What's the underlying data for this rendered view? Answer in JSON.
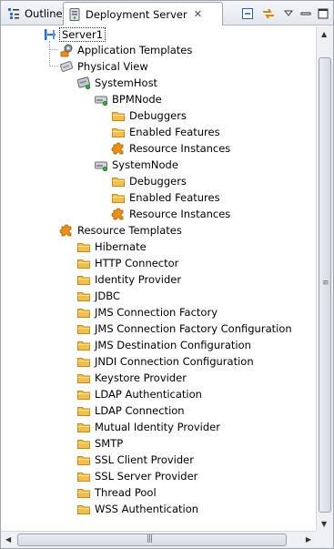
{
  "tabs": {
    "outline_label": "Outline",
    "active_label": "Deployment Server",
    "close_glyph": "✕"
  },
  "toolbar": {
    "collapse_icon": "collapse-all-icon",
    "link_icon": "link-with-editor-icon",
    "menu_icon": "view-menu-icon",
    "minimize_icon": "minimize-icon",
    "maximize_icon": "maximize-icon"
  },
  "tree": {
    "server": "Server1",
    "application_templates": "Application Templates",
    "physical_view": "Physical View",
    "system_host": "SystemHost",
    "bpm_node": {
      "label": "BPMNode",
      "children": [
        "Debuggers",
        "Enabled Features",
        "Resource Instances"
      ]
    },
    "system_node": {
      "label": "SystemNode",
      "children": [
        "Debuggers",
        "Enabled Features",
        "Resource Instances"
      ]
    },
    "resource_templates": {
      "label": "Resource Templates",
      "children": [
        "Hibernate",
        "HTTP Connector",
        "Identity Provider",
        "JDBC",
        "JMS Connection Factory",
        "JMS Connection Factory Configuration",
        "JMS Destination Configuration",
        "JNDI Connection Configuration",
        "Keystore Provider",
        "LDAP Authentication",
        "LDAP Connection",
        "Mutual Identity Provider",
        "SMTP",
        "SSL Client Provider",
        "SSL Server Provider",
        "Thread Pool",
        "WSS Authentication"
      ]
    }
  },
  "colors": {
    "folder": "#f2c04a",
    "folder_edge": "#c18a1a",
    "puzzle": "#e8901a",
    "tab_border": "#9aa3b2"
  }
}
